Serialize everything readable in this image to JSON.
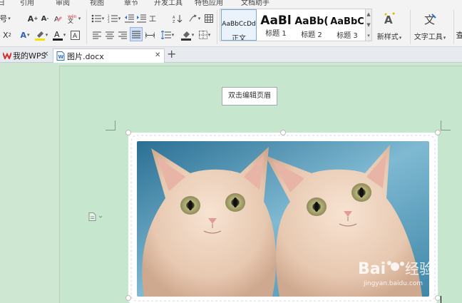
{
  "menu": {
    "tabs": [
      "引用",
      "审阅",
      "视图",
      "章节",
      "开发工具",
      "特色应用",
      "文档助手"
    ]
  },
  "ribbon": {
    "font_size_fragment": "号",
    "styles": [
      {
        "sample": "AaBbCcDd",
        "label": "正文"
      },
      {
        "sample": "AaBl",
        "label": "标题 1"
      },
      {
        "sample": "AaBb(",
        "label": "标题 2"
      },
      {
        "sample": "AaBbC",
        "label": "标题 3"
      }
    ],
    "new_style_label": "新样式",
    "text_tools_label": "文字工具",
    "far_right_fragment": "查"
  },
  "tabs": {
    "home": {
      "label": "我的WPS"
    },
    "doc": {
      "label": "图片.docx"
    }
  },
  "document": {
    "header_hint": "双击编辑页眉"
  },
  "photo": {
    "subject": "two-cream-kittens",
    "frame_style": "scalloped-white"
  },
  "watermark": {
    "brand": "Baidu经验",
    "url": "jingyan.baidu.com"
  },
  "colors": {
    "page_bg": "#cde7d2",
    "tab_accent": "#2e6fbd",
    "font_color_bar": "#1f1f1f",
    "highlight_bar": "#f5e400",
    "shading_bar": "#333333"
  }
}
